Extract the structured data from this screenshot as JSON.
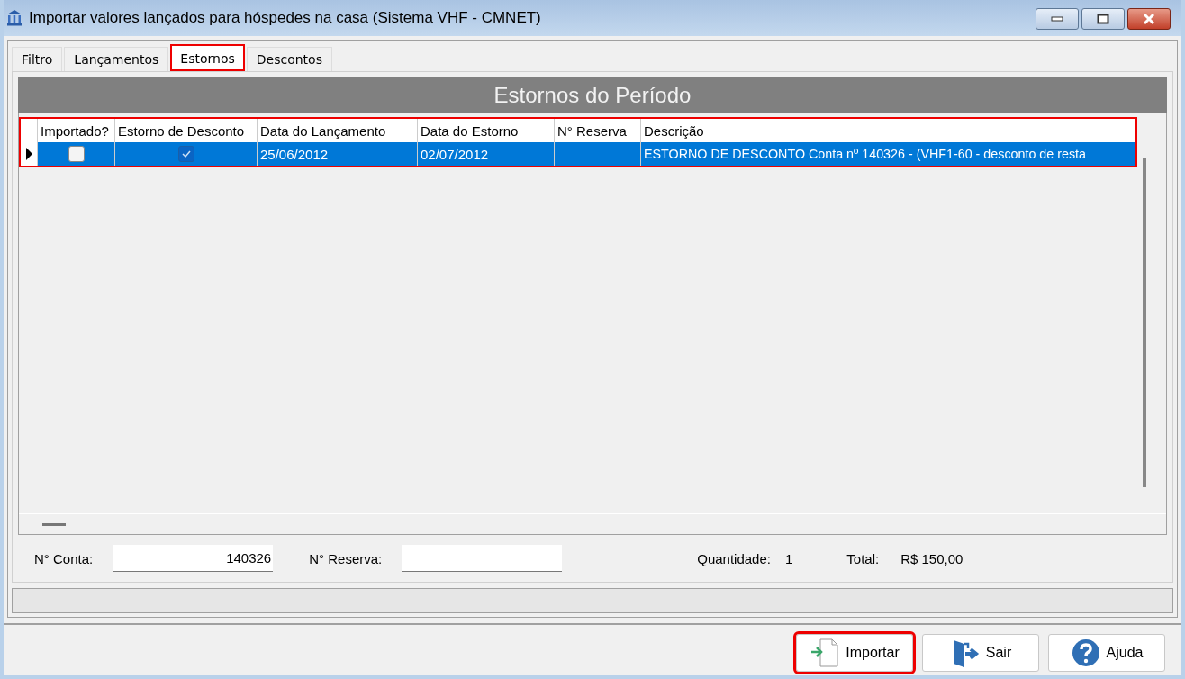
{
  "window": {
    "title": "Importar valores lançados para hóspedes na casa (Sistema VHF - CMNET)"
  },
  "tabs": [
    {
      "label": "Filtro",
      "selected": false,
      "highlighted": false
    },
    {
      "label": "Lançamentos",
      "selected": false,
      "highlighted": false
    },
    {
      "label": "Estornos",
      "selected": true,
      "highlighted": true
    },
    {
      "label": "Descontos",
      "selected": false,
      "highlighted": false
    }
  ],
  "panel_title": "Estornos do Período",
  "table": {
    "highlighted": true,
    "columns": [
      "Importado?",
      "Estorno de Desconto",
      "Data do Lançamento",
      "Data do Estorno",
      "N° Reserva",
      "Descrição"
    ],
    "rows": [
      {
        "selected": true,
        "importado": false,
        "estorno_desconto": true,
        "data_lancamento": "25/06/2012",
        "data_estorno": "02/07/2012",
        "reserva": "",
        "descricao": "ESTORNO DE DESCONTO Conta nº 140326 -  (VHF1-60 - desconto de resta"
      }
    ]
  },
  "footer": {
    "conta_label": "N° Conta:",
    "conta_value": "140326",
    "reserva_label": "N° Reserva:",
    "quantidade_label": "Quantidade:",
    "quantidade_value": "1",
    "total_label": "Total:",
    "total_value": "R$ 150,00"
  },
  "buttons": [
    {
      "kind": "import",
      "label": "Importar",
      "highlighted": true
    },
    {
      "kind": "exit",
      "label": "Sair",
      "highlighted": false
    },
    {
      "kind": "help",
      "label": "Ajuda",
      "highlighted": false
    }
  ]
}
